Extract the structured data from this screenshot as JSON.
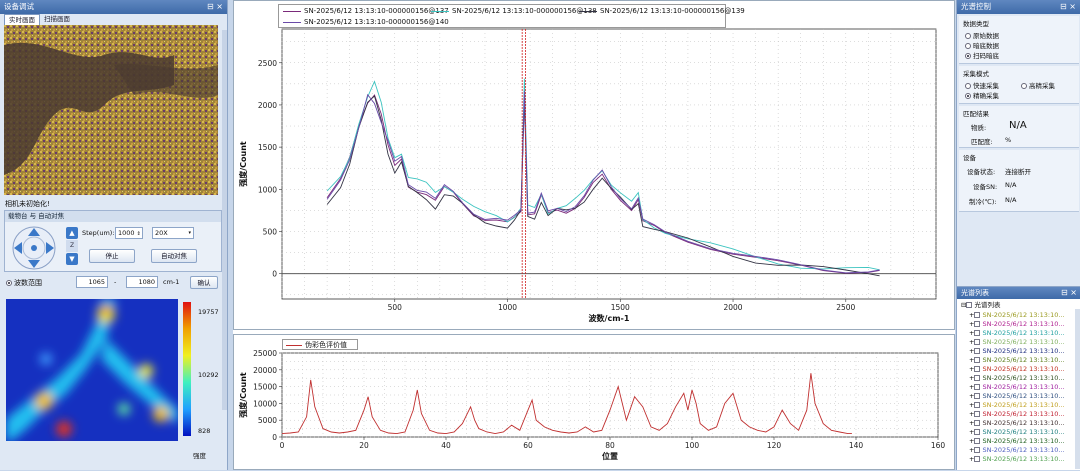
{
  "left": {
    "title": "设备调试",
    "tabs": [
      "实时画面",
      "扫描画面"
    ],
    "camera_status": "相机未初始化!",
    "stage_group_title": "载物台 与 自动对焦",
    "step_label": "Step(um):",
    "step_value": "1000",
    "objective": "20X",
    "stop_label": "停止",
    "autofocus_label": "自动对焦",
    "wave_range_label": "波数范围",
    "wave_from": "1065",
    "wave_sep": "-",
    "wave_to": "1080",
    "wave_unit": "cm-1",
    "confirm_label": "确认",
    "colorbar": {
      "max": "19757",
      "mid": "10292",
      "min": "828",
      "label": "强度"
    }
  },
  "spectrum_chart": {
    "legend": [
      {
        "name": "SN-2025/6/12 13:13:10-000000156@137",
        "color": "#7a2a7a"
      },
      {
        "name": "SN-2025/6/12 13:13:10-000000156@138",
        "color": "#3cc4c0"
      },
      {
        "name": "SN-2025/6/12 13:13:10-000000156@139",
        "color": "#333344"
      },
      {
        "name": "SN-2025/6/12 13:13:10-000000156@140",
        "color": "#6a4aa8"
      }
    ],
    "ylabel": "强度/Count",
    "xlabel": "波数/cm-1"
  },
  "chart_data": [
    {
      "type": "line",
      "xlabel": "波数/cm-1",
      "ylabel": "强度/Count",
      "xlim": [
        0,
        2900
      ],
      "ylim": [
        -300,
        2900
      ],
      "xticks": [
        500,
        1000,
        1500,
        2000,
        2500
      ],
      "yticks": [
        0,
        500,
        1000,
        1500,
        2000,
        2500
      ],
      "markers": [
        1065,
        1080
      ],
      "x": [
        200,
        260,
        300,
        340,
        380,
        410,
        440,
        470,
        500,
        530,
        560,
        600,
        640,
        680,
        720,
        760,
        800,
        850,
        900,
        950,
        1000,
        1030,
        1060,
        1075,
        1090,
        1120,
        1150,
        1180,
        1220,
        1260,
        1300,
        1340,
        1380,
        1420,
        1460,
        1500,
        1550,
        1580,
        1600,
        1650,
        1700,
        1800,
        1900,
        2000,
        2100,
        2200,
        2300,
        2400,
        2500,
        2600,
        2650
      ],
      "series": [
        {
          "name": "SN-2025/6/12 13:13:10-000000156@137",
          "values": [
            900,
            1100,
            1350,
            1750,
            2050,
            2150,
            1900,
            1500,
            1250,
            1350,
            1050,
            1000,
            950,
            850,
            1000,
            950,
            850,
            720,
            650,
            620,
            580,
            650,
            750,
            2150,
            720,
            700,
            900,
            700,
            760,
            750,
            800,
            900,
            1050,
            1150,
            1000,
            900,
            780,
            880,
            600,
            540,
            480,
            400,
            320,
            240,
            170,
            120,
            90,
            60,
            40,
            30,
            20
          ]
        },
        {
          "name": "SN-2025/6/12 13:13:10-000000156@138",
          "values": [
            950,
            1150,
            1400,
            1800,
            2100,
            2250,
            2000,
            1600,
            1400,
            1450,
            1150,
            1100,
            1050,
            950,
            1050,
            1000,
            900,
            780,
            700,
            670,
            630,
            700,
            800,
            2300,
            780,
            760,
            950,
            740,
            800,
            800,
            860,
            960,
            1120,
            1250,
            1080,
            960,
            830,
            930,
            640,
            570,
            510,
            420,
            340,
            260,
            190,
            140,
            100,
            70,
            50,
            40,
            30
          ]
        },
        {
          "name": "SN-2025/6/12 13:13:10-000000156@139",
          "values": [
            850,
            1050,
            1300,
            1700,
            2000,
            2100,
            1850,
            1450,
            1200,
            1300,
            1000,
            950,
            900,
            800,
            950,
            900,
            800,
            680,
            620,
            600,
            560,
            620,
            720,
            2050,
            690,
            680,
            870,
            680,
            740,
            730,
            780,
            880,
            1030,
            1130,
            980,
            880,
            760,
            860,
            590,
            530,
            470,
            390,
            310,
            230,
            160,
            110,
            80,
            50,
            30,
            20,
            10
          ]
        },
        {
          "name": "SN-2025/6/12 13:13:10-000000156@140",
          "values": [
            880,
            1080,
            1320,
            1720,
            2150,
            2050,
            1800,
            1550,
            1300,
            1380,
            1080,
            1020,
            980,
            870,
            1020,
            960,
            860,
            740,
            660,
            640,
            600,
            670,
            770,
            2200,
            740,
            720,
            920,
            720,
            780,
            770,
            820,
            920,
            1080,
            1200,
            1030,
            920,
            800,
            900,
            620,
            550,
            490,
            410,
            330,
            250,
            180,
            130,
            95,
            65,
            45,
            35,
            25
          ]
        }
      ]
    },
    {
      "type": "line",
      "xlabel": "位置",
      "ylabel": "强度/Count",
      "xlim": [
        0,
        160
      ],
      "ylim": [
        0,
        25000
      ],
      "xticks": [
        0,
        20,
        40,
        60,
        80,
        100,
        120,
        140,
        160
      ],
      "yticks": [
        0,
        5000,
        10000,
        15000,
        20000,
        25000
      ],
      "series": [
        {
          "name": "伪彩色评价值",
          "color": "#c03030",
          "x": [
            0,
            2,
            4,
            6,
            7,
            8,
            10,
            12,
            14,
            16,
            18,
            20,
            21,
            22,
            24,
            26,
            28,
            30,
            32,
            33,
            34,
            36,
            38,
            40,
            42,
            44,
            46,
            47,
            48,
            50,
            52,
            54,
            56,
            58,
            60,
            61,
            62,
            64,
            66,
            68,
            70,
            72,
            74,
            76,
            78,
            80,
            82,
            83,
            84,
            86,
            88,
            90,
            92,
            94,
            96,
            98,
            99,
            100,
            101,
            102,
            104,
            106,
            108,
            110,
            111,
            112,
            114,
            116,
            118,
            120,
            122,
            124,
            126,
            128,
            129,
            130,
            132,
            134,
            136,
            138,
            139
          ],
          "values": [
            1000,
            1200,
            1500,
            6000,
            17000,
            9000,
            2500,
            1500,
            1200,
            1500,
            2000,
            8000,
            12000,
            6000,
            2000,
            1200,
            1000,
            1500,
            8000,
            14000,
            7000,
            2000,
            1200,
            1000,
            1500,
            4000,
            9000,
            5000,
            2500,
            1500,
            1000,
            1500,
            3500,
            2000,
            8000,
            11000,
            5000,
            3000,
            2000,
            1500,
            1200,
            1500,
            3000,
            1500,
            2000,
            8000,
            15000,
            10000,
            5000,
            12000,
            9000,
            3000,
            2000,
            4000,
            9000,
            13000,
            8000,
            14000,
            10000,
            4000,
            2000,
            3000,
            10000,
            13000,
            9000,
            5000,
            3000,
            2000,
            1500,
            3000,
            8000,
            4000,
            2000,
            8000,
            19000,
            10000,
            4000,
            2000,
            1500,
            1000,
            1000
          ]
        }
      ]
    }
  ],
  "profile_chart": {
    "legend": "伪彩色评价值",
    "ylabel": "强度/Count",
    "xlabel": "位置"
  },
  "right": {
    "title": "光谱控制",
    "data_type_title": "数据类型",
    "data_types": [
      "原始数据",
      "暗底数据",
      "扫码暗底"
    ],
    "acq_mode_title": "采集模式",
    "acq_modes": [
      "快速采集",
      "高精采集",
      "精确采集"
    ],
    "match_title": "匹配结果",
    "substance_label": "物质:",
    "substance_value": "N/A",
    "match_label": "匹配度:",
    "match_value": "%",
    "device_title": "设备",
    "dev_status_label": "设备状态:",
    "dev_status_value": "连接断开",
    "dev_sn_label": "设备SN:",
    "dev_sn_value": "N/A",
    "cooling_label": "制冷(℃):",
    "cooling_value": "N/A",
    "list_title": "光谱列表",
    "list_root": "光谱列表",
    "list_items": [
      {
        "text": "SN-2025/6/12 13:13:10...",
        "color": "#9a9a20"
      },
      {
        "text": "SN-2025/6/12 13:13:10...",
        "color": "#b02090"
      },
      {
        "text": "SN-2025/6/12 13:13:10...",
        "color": "#20a0a0"
      },
      {
        "text": "SN-2025/6/12 13:13:10...",
        "color": "#80b060"
      },
      {
        "text": "SN-2025/6/12 13:13:10...",
        "color": "#203080"
      },
      {
        "text": "SN-2025/6/12 13:13:10...",
        "color": "#608020"
      },
      {
        "text": "SN-2025/6/12 13:13:10...",
        "color": "#c03020"
      },
      {
        "text": "SN-2025/6/12 13:13:10...",
        "color": "#305020"
      },
      {
        "text": "SN-2025/6/12 13:13:10...",
        "color": "#a020a0"
      },
      {
        "text": "SN-2025/6/12 13:13:10...",
        "color": "#305080"
      },
      {
        "text": "SN-2025/6/12 13:13:10...",
        "color": "#c0a020"
      },
      {
        "text": "SN-2025/6/12 13:13:10...",
        "color": "#c02030"
      },
      {
        "text": "SN-2025/6/12 13:13:10...",
        "color": "#403030"
      },
      {
        "text": "SN-2025/6/12 13:13:10...",
        "color": "#208080"
      },
      {
        "text": "SN-2025/6/12 13:13:10...",
        "color": "#206020"
      },
      {
        "text": "SN-2025/6/12 13:13:10...",
        "color": "#5060c0"
      },
      {
        "text": "SN-2025/6/12 13:13:10...",
        "color": "#50a050"
      }
    ]
  }
}
